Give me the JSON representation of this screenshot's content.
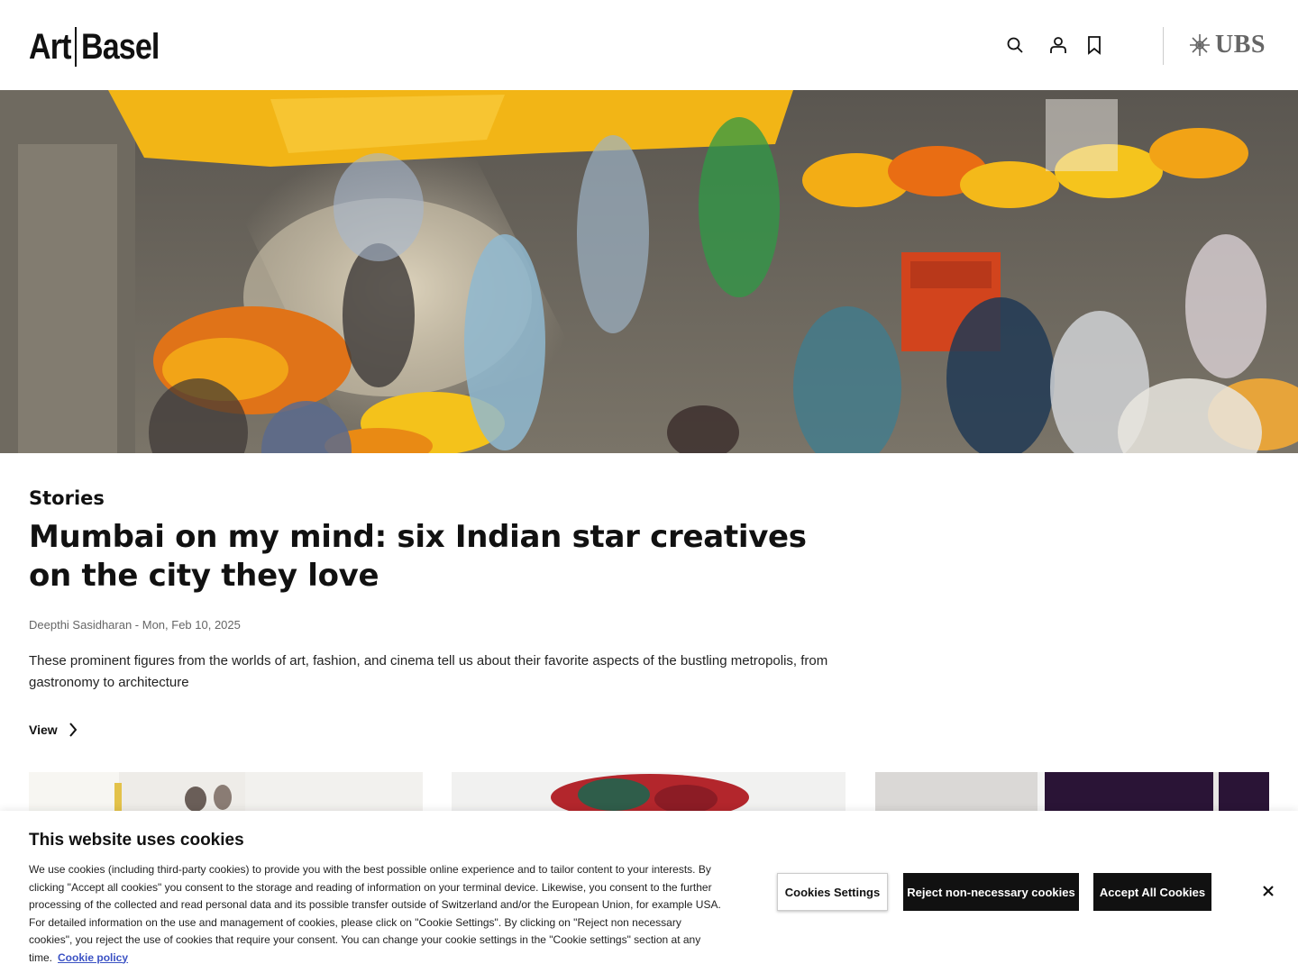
{
  "header": {
    "logo_word1": "Art",
    "logo_word2": "Basel",
    "icons": [
      "search-icon",
      "account-icon",
      "bookmark-icon"
    ],
    "partner": "UBS"
  },
  "article": {
    "category": "Stories",
    "title": "Mumbai on my mind: six Indian star creatives on the city they love",
    "meta": "Deepthi Sasidharan - Mon, Feb 10, 2025",
    "summary": "These prominent figures from the worlds of art, fashion, and cinema tell us about their favorite aspects of the bustling metropolis, from gastronomy to architecture",
    "view_label": "View"
  },
  "cookie_banner": {
    "title": "This website uses cookies",
    "text": "We use cookies (including third-party cookies) to provide you with the best possible online experience and to tailor content to your interests. By clicking \"Accept all cookies\" you consent to the storage and reading of information on your terminal device. Likewise, you consent to the further processing of the collected and read personal data and its possible transfer outside of Switzerland and/or the European Union, for example USA. For detailed information on the use and management of cookies, please click on \"Cookie Settings\". By clicking on \"Reject non necessary cookies\", you reject the use of cookies that require your consent. You can change your cookie settings in the \"Cookie settings\" section at any time.",
    "policy_link": "Cookie policy",
    "settings_label": "Cookies Settings",
    "reject_label": "Reject non-necessary cookies",
    "accept_label": "Accept All Cookies"
  },
  "colors": {
    "accent": "#111111",
    "link": "#3b52c4",
    "muted": "#666666"
  }
}
